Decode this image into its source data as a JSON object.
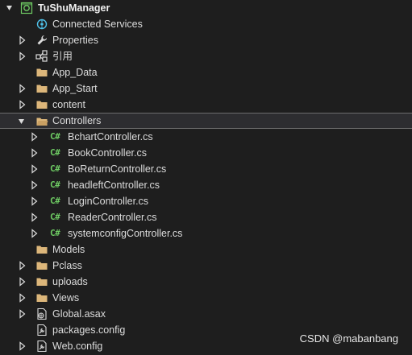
{
  "solution_explorer": {
    "project": {
      "name": "TuShuManager",
      "icon": "csharp-project-icon"
    },
    "items": [
      {
        "label": "Connected Services",
        "icon": "connected-services-icon",
        "expandable": false
      },
      {
        "label": "Properties",
        "icon": "wrench-icon",
        "expandable": true,
        "expanded": false
      },
      {
        "label": "引用",
        "icon": "references-icon",
        "expandable": true,
        "expanded": false
      },
      {
        "label": "App_Data",
        "icon": "folder-icon",
        "expandable": false
      },
      {
        "label": "App_Start",
        "icon": "folder-icon",
        "expandable": true,
        "expanded": false
      },
      {
        "label": "content",
        "icon": "folder-icon",
        "expandable": true,
        "expanded": false
      },
      {
        "label": "Controllers",
        "icon": "folder-open-icon",
        "expandable": true,
        "expanded": true,
        "selected": true
      },
      {
        "label": "Models",
        "icon": "folder-icon",
        "expandable": false
      },
      {
        "label": "Pclass",
        "icon": "folder-icon",
        "expandable": true,
        "expanded": false
      },
      {
        "label": "uploads",
        "icon": "folder-icon",
        "expandable": true,
        "expanded": false
      },
      {
        "label": "Views",
        "icon": "folder-icon",
        "expandable": true,
        "expanded": false
      },
      {
        "label": "Global.asax",
        "icon": "asax-file-icon",
        "expandable": true,
        "expanded": false
      },
      {
        "label": "packages.config",
        "icon": "config-file-icon",
        "expandable": false
      },
      {
        "label": "Web.config",
        "icon": "config-file-icon",
        "expandable": true,
        "expanded": false
      }
    ],
    "controllers": [
      {
        "label": "BchartController.cs",
        "icon_text": "C#"
      },
      {
        "label": "BookController.cs",
        "icon_text": "C#"
      },
      {
        "label": "BoReturnController.cs",
        "icon_text": "C#"
      },
      {
        "label": "headleftController.cs",
        "icon_text": "C#"
      },
      {
        "label": "LoginController.cs",
        "icon_text": "C#"
      },
      {
        "label": "ReaderController.cs",
        "icon_text": "C#"
      },
      {
        "label": "systemconfigController.cs",
        "icon_text": "C#"
      }
    ]
  },
  "watermark": "CSDN @mabanbang",
  "colors": {
    "background": "#1e1e1e",
    "text": "#dcdcdc",
    "folder": "#dcb67a",
    "csharp": "#6ecb63",
    "selected_row": "#2d2d30"
  }
}
